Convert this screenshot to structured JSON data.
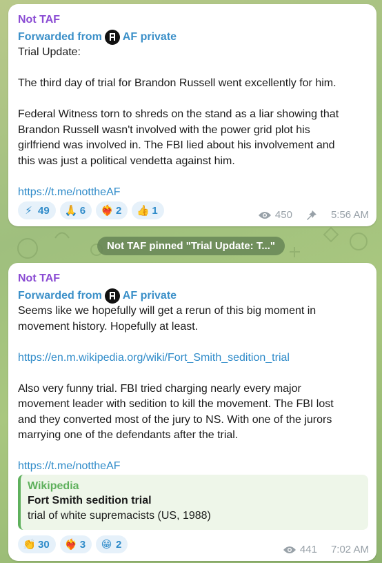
{
  "messages": [
    {
      "sender": "Not TAF",
      "forwarded_prefix": "Forwarded from",
      "forwarded_name": "AF private",
      "lines": [
        "Trial Update:",
        "",
        "The third day of trial for Brandon Russell went excellently for him.",
        "",
        "Federal Witness torn to shreds on the stand as a liar showing that",
        "Brandon Russell wasn't involved with the power grid plot his",
        "girlfriend was involved in. The FBI lied about his involvement and",
        "this was just a political vendetta against him.",
        ""
      ],
      "link": "https://t.me/nottheAF",
      "reactions": [
        {
          "emoji": "⚡",
          "count": "49"
        },
        {
          "emoji": "🙏",
          "count": "6"
        },
        {
          "emoji": "❤️‍🔥",
          "count": "2"
        },
        {
          "emoji": "👍",
          "count": "1"
        }
      ],
      "views": "450",
      "time": "5:56 AM"
    },
    {
      "sender": "Not TAF",
      "forwarded_prefix": "Forwarded from",
      "forwarded_name": "AF private",
      "lines_a": [
        "Seems like we hopefully will get a rerun of this big moment in",
        "movement history. Hopefully at least.",
        ""
      ],
      "link_a": "https://en.m.wikipedia.org/wiki/Fort_Smith_sedition_trial",
      "lines_b": [
        "",
        "Also very funny trial. FBI tried charging nearly every major",
        "movement leader with sedition to kill the movement. The FBI lost",
        "and they converted most of the jury to NS. With one of the jurors",
        "marrying one of the defendants after the trial.",
        ""
      ],
      "link_b": "https://t.me/nottheAF",
      "preview": {
        "site": "Wikipedia",
        "title": "Fort Smith sedition trial",
        "description": "trial of white supremacists (US, 1988)"
      },
      "reactions": [
        {
          "emoji": "👏",
          "count": "30"
        },
        {
          "emoji": "❤️‍🔥",
          "count": "3"
        },
        {
          "emoji": "😁",
          "count": "2"
        }
      ],
      "views": "441",
      "time": "7:02 AM"
    }
  ],
  "pin_banner": "Not TAF pinned \"Trial Update:  T...\"",
  "colors": {
    "sender": "#8a4bd3",
    "forward": "#3a8fc8",
    "link": "#2f8bc9",
    "preview_accent": "#5eb05c",
    "meta": "#98a1a8"
  },
  "icons": {
    "views": "eye-icon",
    "pinned": "pin-icon",
    "forward_avatar": "af-avatar-icon"
  }
}
